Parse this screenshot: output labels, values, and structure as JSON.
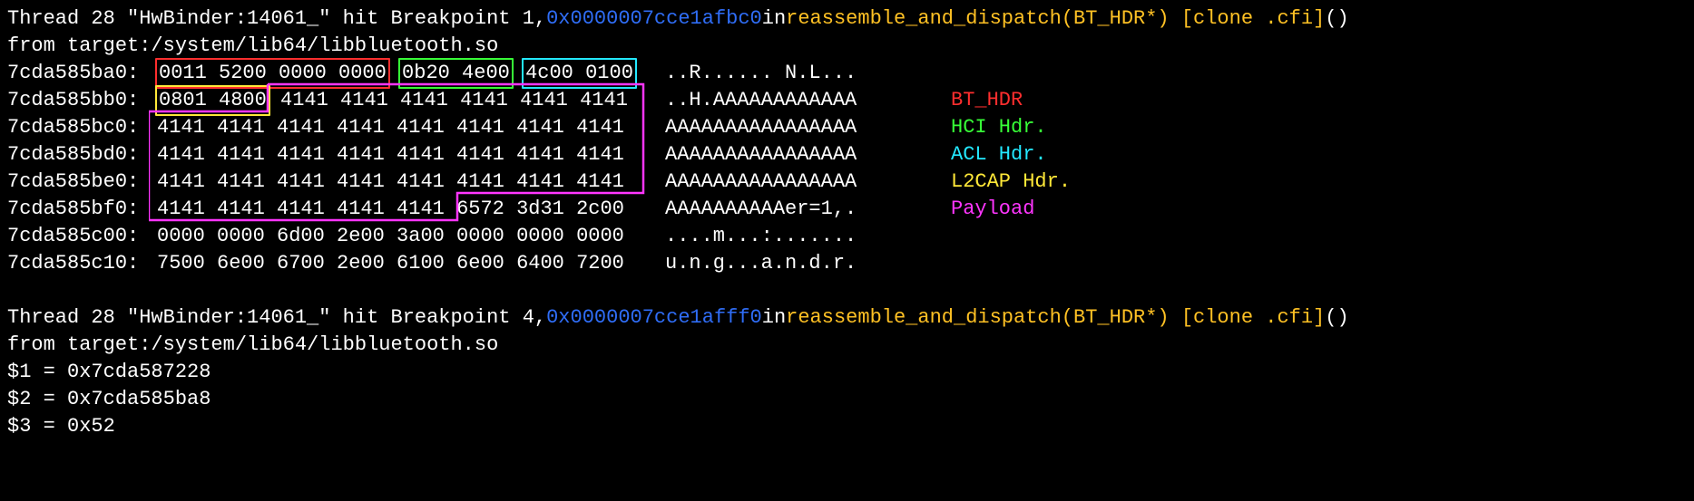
{
  "bp1": {
    "prefix": "Thread 28 \"HwBinder:14061_\" hit Breakpoint 1, ",
    "addr": "0x0000007cce1afbc0",
    "mid": " in ",
    "func": "reassemble_and_dispatch(BT_HDR*) [clone .cfi]",
    "suffix": " ()",
    "from": "   from target:/system/lib64/libbluetooth.so"
  },
  "hex": {
    "rows": [
      {
        "addr": "7cda585ba0:",
        "g_bt": "0011 5200 0000 0000",
        "g_hci": "0b20 4e00",
        "g_acl": "4c00 0100",
        "ascii": "..R...... N.L..."
      },
      {
        "addr": "7cda585bb0:",
        "g_l2": "0801 4800",
        "g_rest": "4141 4141 4141 4141 4141 4141",
        "ascii": "..H.AAAAAAAAAAAA"
      },
      {
        "addr": "7cda585bc0:",
        "g_rest": "4141 4141 4141 4141 4141 4141 4141 4141",
        "ascii": "AAAAAAAAAAAAAAAA"
      },
      {
        "addr": "7cda585bd0:",
        "g_rest": "4141 4141 4141 4141 4141 4141 4141 4141",
        "ascii": "AAAAAAAAAAAAAAAA"
      },
      {
        "addr": "7cda585be0:",
        "g_rest": "4141 4141 4141 4141 4141 4141 4141 4141",
        "ascii": "AAAAAAAAAAAAAAAA"
      },
      {
        "addr": "7cda585bf0:",
        "g_rest": "4141 4141 4141 4141 4141",
        "g_tail": "6572 3d31 2c00",
        "ascii": "AAAAAAAAAAer=1,."
      },
      {
        "addr": "7cda585c00:",
        "g_rest": "0000 0000 6d00 2e00 3a00 0000 0000 0000",
        "ascii": "....m...:......."
      },
      {
        "addr": "7cda585c10:",
        "g_rest": "7500 6e00 6700 2e00 6100 6e00 6400 7200",
        "ascii": "u.n.g...a.n.d.r."
      }
    ]
  },
  "legend": {
    "bt": "BT_HDR",
    "hci": "HCI Hdr.",
    "acl": "ACL Hdr.",
    "l2": "L2CAP Hdr.",
    "pay": "Payload"
  },
  "bp4": {
    "prefix": "Thread 28 \"HwBinder:14061_\" hit Breakpoint 4, ",
    "addr": "0x0000007cce1afff0",
    "mid": " in ",
    "func": "reassemble_and_dispatch(BT_HDR*) [clone .cfi]",
    "suffix": " ()",
    "from": "   from target:/system/lib64/libbluetooth.so"
  },
  "vars": {
    "v1": "$1 = 0x7cda587228",
    "v2": "$2 = 0x7cda585ba8",
    "v3": "$3 = 0x52"
  }
}
